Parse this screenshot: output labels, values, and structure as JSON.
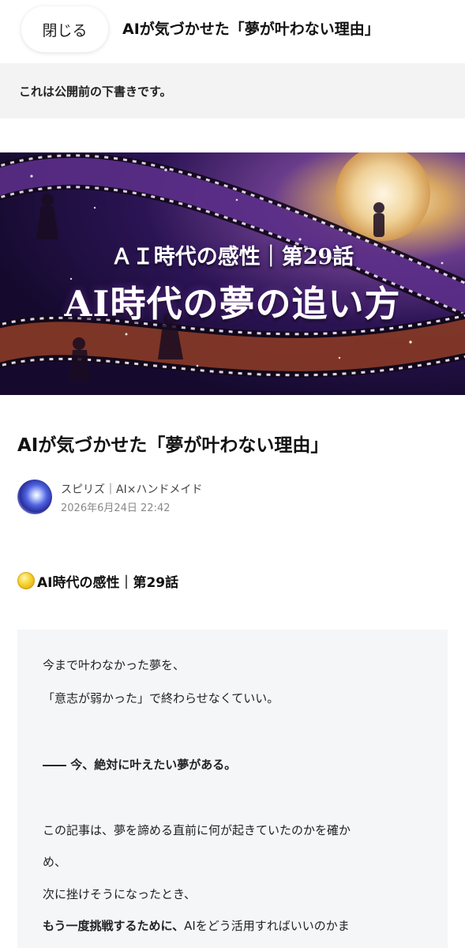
{
  "header": {
    "close_label": "閉じる",
    "title": "AIが気づかせた「夢が叶わない理由」"
  },
  "draft_notice": "これは公開前の下書きです。",
  "hero": {
    "subtitle": "ＡＩ時代の感性｜第29話",
    "title": "AI時代の夢の追い方"
  },
  "article": {
    "title": "AIが気づかせた「夢が叶わない理由」",
    "author": "スピリズ｜AI×ハンドメイド",
    "date": "2026年6月24日 22:42",
    "section_heading": "AI時代の感性｜第29話",
    "quote": {
      "line1": "今まで叶わなかった夢を、",
      "line2": "「意志が弱かった」で終わらせなくていい。",
      "line3": "―― 今、絶対に叶えたい夢がある。",
      "line4": "この記事は、夢を諦める直前に何が起きていたのかを確か",
      "line5": "め、",
      "line6": "次に挫けそうになったとき、",
      "line7_bold": "もう一度挑戦するために、",
      "line7_rest": "AIをどう活用すればいいのかま"
    }
  },
  "icons": {
    "section": "coin-icon",
    "avatar": "author-avatar"
  },
  "colors": {
    "draft_banner_bg": "#f3f3f3",
    "quote_bg": "#f4f6f8",
    "coin": "#f5cf2a"
  }
}
